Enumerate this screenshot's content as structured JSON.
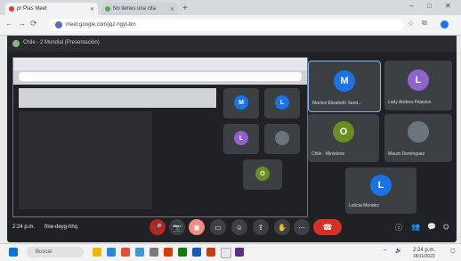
{
  "browser": {
    "tabs": [
      {
        "label": "pr Plas Meet"
      },
      {
        "label": "No tienes una cita"
      }
    ],
    "url": "meet.google.com/jqz-hgyt-tkn",
    "new_tab": "+",
    "controls": [
      "–",
      "□",
      "✕"
    ]
  },
  "meet": {
    "title": "Chile - 2 Mundial (Presentación)",
    "time": "2:24 p.m.",
    "meeting_code": "fme-deyg-hhq",
    "participants": [
      {
        "initial": "M",
        "name": "Marisol Elizabeth Sand...",
        "color": "#1a73e8"
      },
      {
        "initial": "L",
        "name": "Lady Andrea Palacios",
        "color": "#8e63ce"
      },
      {
        "initial": "O",
        "name": "Chile - Ministerio",
        "color": "#6b8e23"
      },
      {
        "initial": "",
        "name": "Mauro Domínguez",
        "color": "#6c757d"
      },
      {
        "initial": "L",
        "name": "Letícia Mendez",
        "color": "#1a73e8"
      }
    ],
    "nested_tiles": [
      {
        "initial": "M",
        "color": "#1a73e8"
      },
      {
        "initial": "L",
        "color": "#1a73e8"
      },
      {
        "initial": "L",
        "color": "#8e63ce"
      },
      {
        "initial": "",
        "color": "#6c757d"
      },
      {
        "initial": "O",
        "color": "#6b8e23"
      }
    ],
    "controls": [
      "🎤",
      "📷",
      "✋",
      "⋯",
      "💬",
      "☺",
      "▣"
    ]
  },
  "taskbar": {
    "search_placeholder": "Buscar",
    "time": "2:24 p.m.",
    "date": "18/11/2023"
  }
}
